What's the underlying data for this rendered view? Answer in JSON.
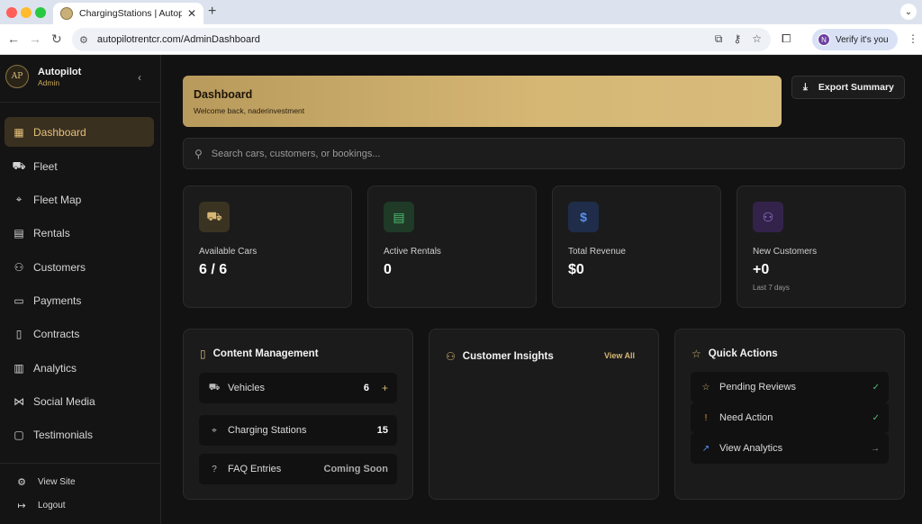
{
  "browser": {
    "tab_title": "ChargingStations | Autopilot R",
    "url": "autopilotrentcr.com/AdminDashboard",
    "verify_label": "Verify it's you",
    "profile_initial": "N"
  },
  "sidebar": {
    "brand_name": "Autopilot",
    "brand_role": "Admin",
    "logo_text": "AP",
    "items": [
      {
        "label": "Dashboard",
        "icon": "dashboard-grid-icon"
      },
      {
        "label": "Fleet",
        "icon": "car-icon"
      },
      {
        "label": "Fleet Map",
        "icon": "map-pin-icon"
      },
      {
        "label": "Rentals",
        "icon": "calendar-icon"
      },
      {
        "label": "Customers",
        "icon": "users-icon"
      },
      {
        "label": "Payments",
        "icon": "credit-card-icon"
      },
      {
        "label": "Contracts",
        "icon": "document-icon"
      },
      {
        "label": "Analytics",
        "icon": "bar-chart-icon"
      },
      {
        "label": "Social Media",
        "icon": "share-icon"
      },
      {
        "label": "Testimonials",
        "icon": "message-icon"
      }
    ],
    "footer": [
      {
        "label": "View Site",
        "icon": "gear-icon"
      },
      {
        "label": "Logout",
        "icon": "logout-icon"
      }
    ]
  },
  "header": {
    "title": "Dashboard",
    "subtitle": "Welcome back, naderinvestment",
    "export_label": "Export Summary"
  },
  "search": {
    "placeholder": "Search cars, customers, or bookings..."
  },
  "stats": [
    {
      "label": "Available Cars",
      "value": "6 / 6",
      "note": "",
      "icon": "car-icon",
      "color": "#d6b774"
    },
    {
      "label": "Active Rentals",
      "value": "0",
      "note": "",
      "icon": "calendar-icon",
      "color": "#4fbf72"
    },
    {
      "label": "Total Revenue",
      "value": "$0",
      "note": "",
      "icon": "dollar-icon",
      "color": "#5b8ff0"
    },
    {
      "label": "New Customers",
      "value": "+0",
      "note": "Last 7 days",
      "icon": "users-icon",
      "color": "#a77be0"
    }
  ],
  "content_management": {
    "title": "Content Management",
    "rows": [
      {
        "label": "Vehicles",
        "value": "6"
      },
      {
        "label": "Charging Stations",
        "value": "15"
      },
      {
        "label": "FAQ Entries",
        "value": "Coming Soon"
      }
    ]
  },
  "customer_insights": {
    "title": "Customer Insights",
    "view_all": "View All"
  },
  "quick_actions": {
    "title": "Quick Actions",
    "items": [
      {
        "label": "Pending Reviews",
        "icon": "star-icon",
        "trail": "check-circle-icon"
      },
      {
        "label": "Need Action",
        "icon": "alert-circle-icon",
        "trail": "check-circle-icon"
      },
      {
        "label": "View Analytics",
        "icon": "trending-up-icon",
        "trail": "arrow-right-icon"
      }
    ]
  }
}
